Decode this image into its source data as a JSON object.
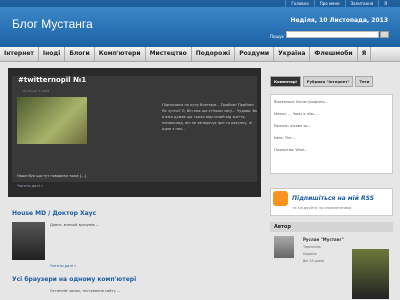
{
  "toplinks": [
    "Головна",
    "Про мене",
    "Запитання",
    "Я"
  ],
  "header": {
    "logo": "Блог Мустанга",
    "date": "Неділя, 10 Листопада, 2013",
    "search_label": "Пошук"
  },
  "nav": [
    "Інтернет",
    "Іноді",
    "Блоги",
    "Комп'ютери",
    "Мистецтво",
    "Подорожі",
    "Роздуми",
    "Україна",
    "Флешмоби",
    "Я"
  ],
  "feature": {
    "title": "#twitternopil №1",
    "meta": "05.09.Apr 5 2008",
    "text": "Підписався на купу блогерів... Прийом! Прийом! Як чутно? О, Він має ще стільки часу... Чудово, бо я вже думав що трохи відсталий від життя, наприклад, він не заперечує ідеї та рахунку, ні одне з них...",
    "caption": "Наше бук що тут говорити тоже [...]",
    "more": "Читати далі »"
  },
  "posts": [
    {
      "title": "House MD / Доктор Хаус",
      "text": "Давнє, вчений зрозумів ...",
      "more": "Читати далі »"
    },
    {
      "title": "Усі браузери на одному комп'ютері",
      "text": "Останнім часом, тестування сайту ..."
    }
  ],
  "sidebar": {
    "tabs": [
      "Коментарі",
      "Рубрика \"Інтернет\"",
      "Теги"
    ],
    "comments": [
      "Blackmoon: Катастрофічна...",
      "Maxon: ... Чому в лінь...",
      "Ромчик: цікаво як...",
      "Nero: The ...",
      "Пожертва: Wise..."
    ],
    "rss_title": "Підпишіться на мій RSS",
    "rss_sub": "та слідкуйте за оновленнями",
    "author_head": "Автор",
    "author_name": "Руслан \"Мустанг\"",
    "author_lines": [
      "Тернопіль",
      "Україна",
      "Вік 19 років"
    ]
  }
}
